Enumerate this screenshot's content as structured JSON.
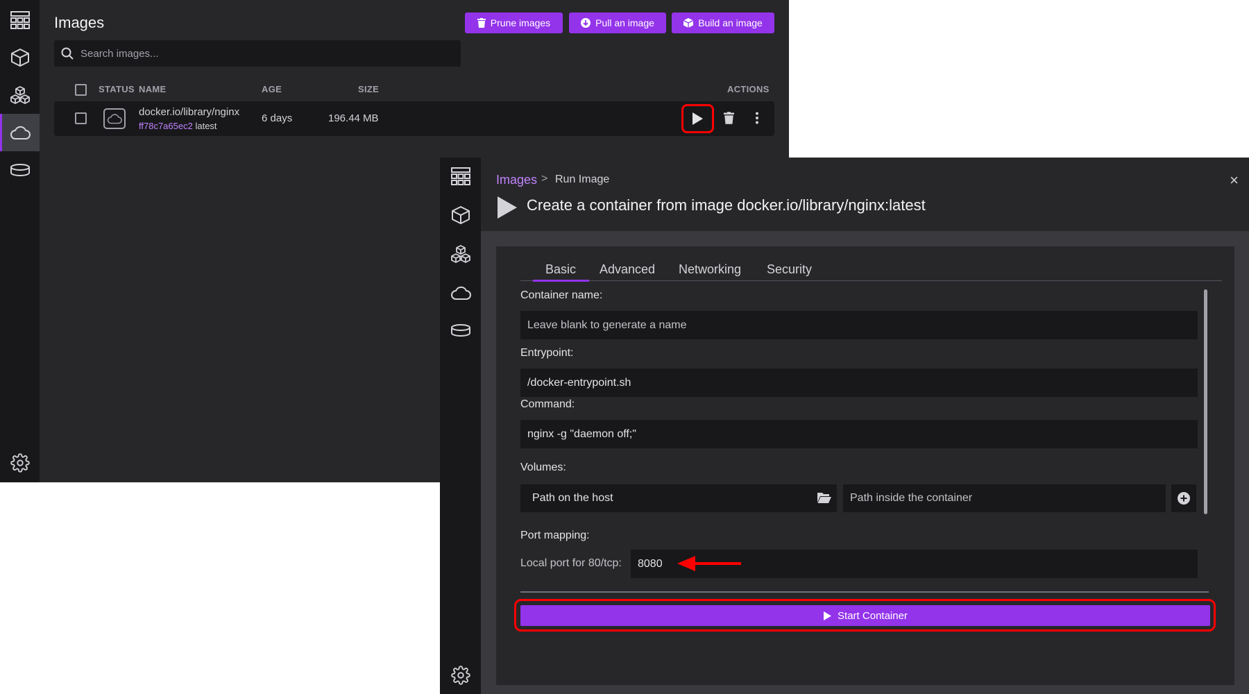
{
  "images_window": {
    "title": "Images",
    "buttons": {
      "prune": "Prune images",
      "pull": "Pull an image",
      "build": "Build an image"
    },
    "search": {
      "placeholder": "Search images..."
    },
    "columns": {
      "status": "STATUS",
      "name": "NAME",
      "age": "AGE",
      "size": "SIZE",
      "actions": "ACTIONS"
    },
    "rows": [
      {
        "name": "docker.io/library/nginx",
        "id": "ff78c7a65ec2",
        "tag": "latest",
        "age": "6 days",
        "size": "196.44 MB"
      }
    ],
    "nav_icons": [
      "dashboard-icon",
      "containers-cube-icon",
      "pods-cubes-icon",
      "images-cloud-icon",
      "volumes-disk-icon",
      "settings-gear-icon"
    ]
  },
  "run_window": {
    "breadcrumb": {
      "parent": "Images",
      "separator": ">",
      "current": "Run Image"
    },
    "title": "Create a container from image docker.io/library/nginx:latest",
    "close_label": "×",
    "tabs": [
      "Basic",
      "Advanced",
      "Networking",
      "Security"
    ],
    "active_tab": "Basic",
    "form": {
      "container_name_label": "Container name:",
      "container_name_placeholder": "Leave blank to generate a name",
      "entrypoint_label": "Entrypoint:",
      "entrypoint_value": "/docker-entrypoint.sh",
      "command_label": "Command:",
      "command_value": "nginx -g \"daemon off;\"",
      "volumes_label": "Volumes:",
      "volume_host_placeholder": "Path on the host",
      "volume_container_placeholder": "Path inside the container",
      "port_mapping_label": "Port mapping:",
      "port_label": "Local port for 80/tcp:",
      "port_value": "8080"
    },
    "start_button": "Start Container"
  },
  "colors": {
    "accent": "#9333ea",
    "link": "#c084fc",
    "highlight": "#ff0000",
    "bg_dark": "#18181b",
    "bg": "#27272a"
  }
}
